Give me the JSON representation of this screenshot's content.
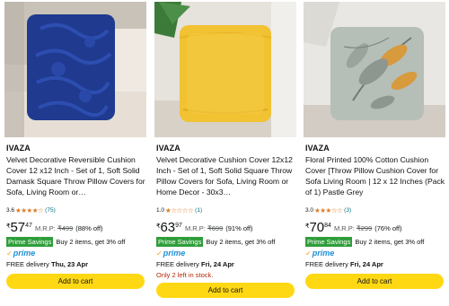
{
  "products": [
    {
      "brand": "IVAZA",
      "title": "Velvet Decorative Reversible Cushion Cover 12 x12 Inch - Set of 1, Soft Solid Damask Square Throw Pillow Covers for Sofa, Living Room or…",
      "rating": "3.6",
      "stars": "★★★★☆",
      "reviews": "(75)",
      "currency": "₹",
      "price_whole": "57",
      "price_fraction": "47",
      "mrp_label": "M.R.P:",
      "mrp": "₹499",
      "discount": "(88% off)",
      "savings_badge": "Prime Savings",
      "savings_text": "Buy 2 items, get 3% off",
      "prime_label": "prime",
      "delivery_prefix": "FREE delivery",
      "delivery_date": "Thu, 23 Apr",
      "stock_note": "",
      "cart_label": "Add to cart"
    },
    {
      "brand": "IVAZA",
      "title": "Velvet Decorative Cushion Cover 12x12 Inch - Set of 1, Soft Solid Square Throw Pillow Covers for Sofa, Living Room or Home Decor - 30x3…",
      "rating": "1.0",
      "stars": "★☆☆☆☆",
      "reviews": "(1)",
      "currency": "₹",
      "price_whole": "63",
      "price_fraction": "97",
      "mrp_label": "M.R.P:",
      "mrp": "₹699",
      "discount": "(91% off)",
      "savings_badge": "Prime Savings",
      "savings_text": "Buy 2 items, get 3% off",
      "prime_label": "prime",
      "delivery_prefix": "FREE delivery",
      "delivery_date": "Fri, 24 Apr",
      "stock_note": "Only 2 left in stock.",
      "cart_label": "Add to cart"
    },
    {
      "brand": "IVAZA",
      "title": "Floral Printed 100% Cotton Cushion Cover [Throw Pillow Cushion Cover for Sofa Living Room | 12 x 12 Inches (Pack of 1) Pastle Grey",
      "rating": "3.0",
      "stars": "★★★☆☆",
      "reviews": "(3)",
      "currency": "₹",
      "price_whole": "70",
      "price_fraction": "84",
      "mrp_label": "M.R.P:",
      "mrp": "₹299",
      "discount": "(76% off)",
      "savings_badge": "Prime Savings",
      "savings_text": "Buy 2 items, get 3% off",
      "prime_label": "prime",
      "delivery_prefix": "FREE delivery",
      "delivery_date": "Fri, 24 Apr",
      "stock_note": "",
      "cart_label": "Add to cart"
    }
  ],
  "colors": {
    "add_to_cart": "#FFD814",
    "prime_savings": "#2F9E3A",
    "star": "#DE7921",
    "link": "#007185",
    "stock_warning": "#B12704",
    "prime_blue": "#1F8FD6"
  },
  "icons": {
    "prime_check": "check-icon",
    "star": "star-icon"
  }
}
